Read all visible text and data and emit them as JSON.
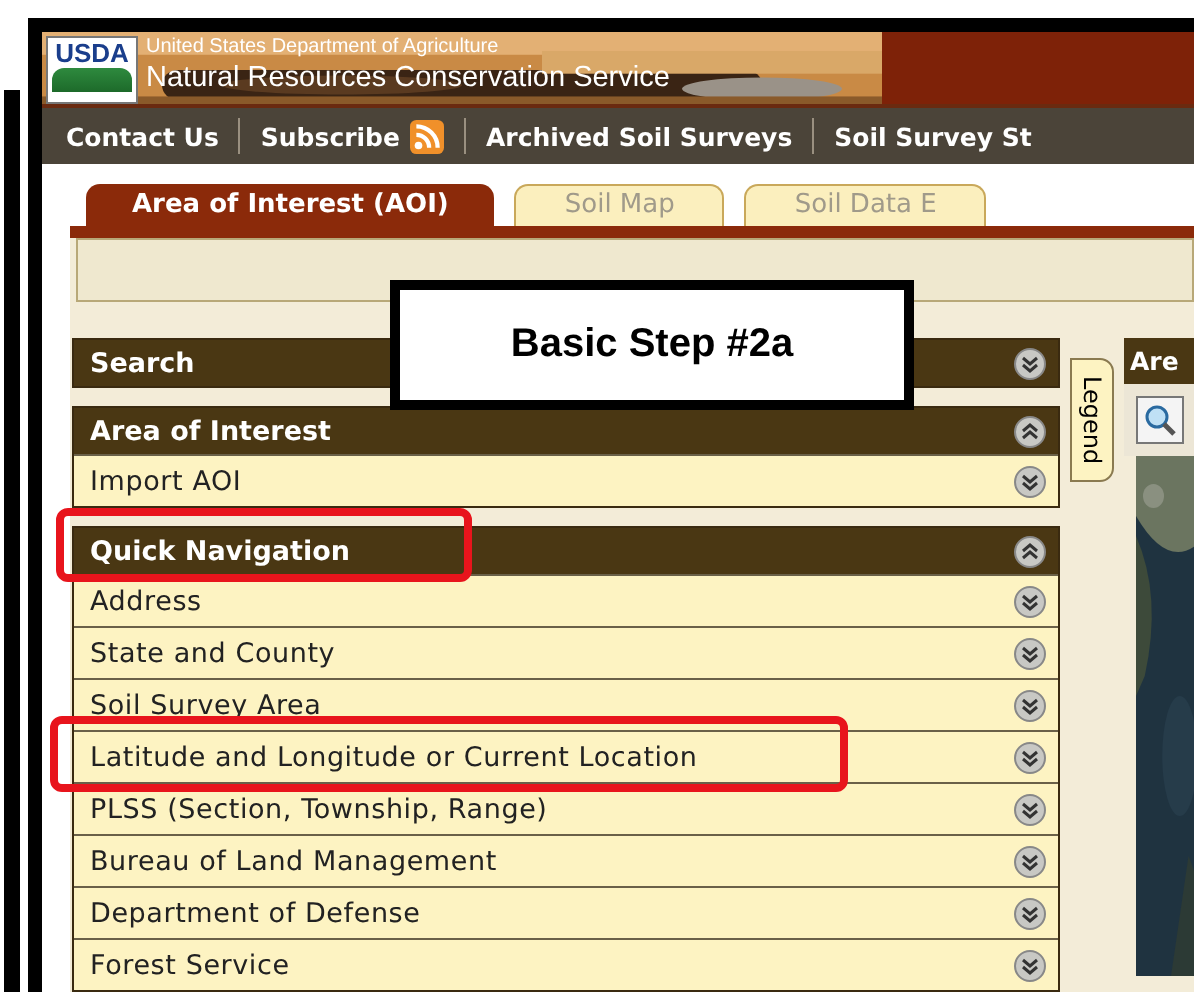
{
  "header": {
    "logo": "USDA",
    "agency": "United States Department of Agriculture",
    "service": "Natural Resources Conservation Service"
  },
  "nav_links": [
    {
      "label": "Contact Us",
      "kind": "link"
    },
    {
      "label": "Subscribe",
      "kind": "feed"
    },
    {
      "label": "Archived Soil Surveys",
      "kind": "link"
    },
    {
      "label": "Soil Survey St",
      "kind": "link"
    }
  ],
  "tabs": [
    {
      "label": "Area of Interest (AOI)",
      "selected": true
    },
    {
      "label": "Soil Map",
      "selected": false
    },
    {
      "label": "Soil Data E",
      "selected": false
    }
  ],
  "sections": [
    {
      "title": "Search",
      "expanded": false,
      "highlighted": false
    },
    {
      "title": "Area of Interest",
      "expanded": true,
      "highlighted": false,
      "items": [
        {
          "label": "Import AOI",
          "highlighted": false
        }
      ]
    },
    {
      "title": "Quick Navigation",
      "expanded": true,
      "highlighted": true,
      "items": [
        {
          "label": "Address",
          "highlighted": false
        },
        {
          "label": "State and County",
          "highlighted": false
        },
        {
          "label": "Soil Survey Area",
          "highlighted": false
        },
        {
          "label": "Latitude and Longitude or Current Location",
          "highlighted": true
        },
        {
          "label": "PLSS (Section, Township, Range)",
          "highlighted": false
        },
        {
          "label": "Bureau of Land Management",
          "highlighted": false
        },
        {
          "label": "Department of Defense",
          "highlighted": false
        },
        {
          "label": "Forest Service",
          "highlighted": false
        }
      ]
    }
  ],
  "legend_tab": "Legend",
  "map_panel": {
    "title": "Are"
  },
  "callout": "Basic Step #2a"
}
